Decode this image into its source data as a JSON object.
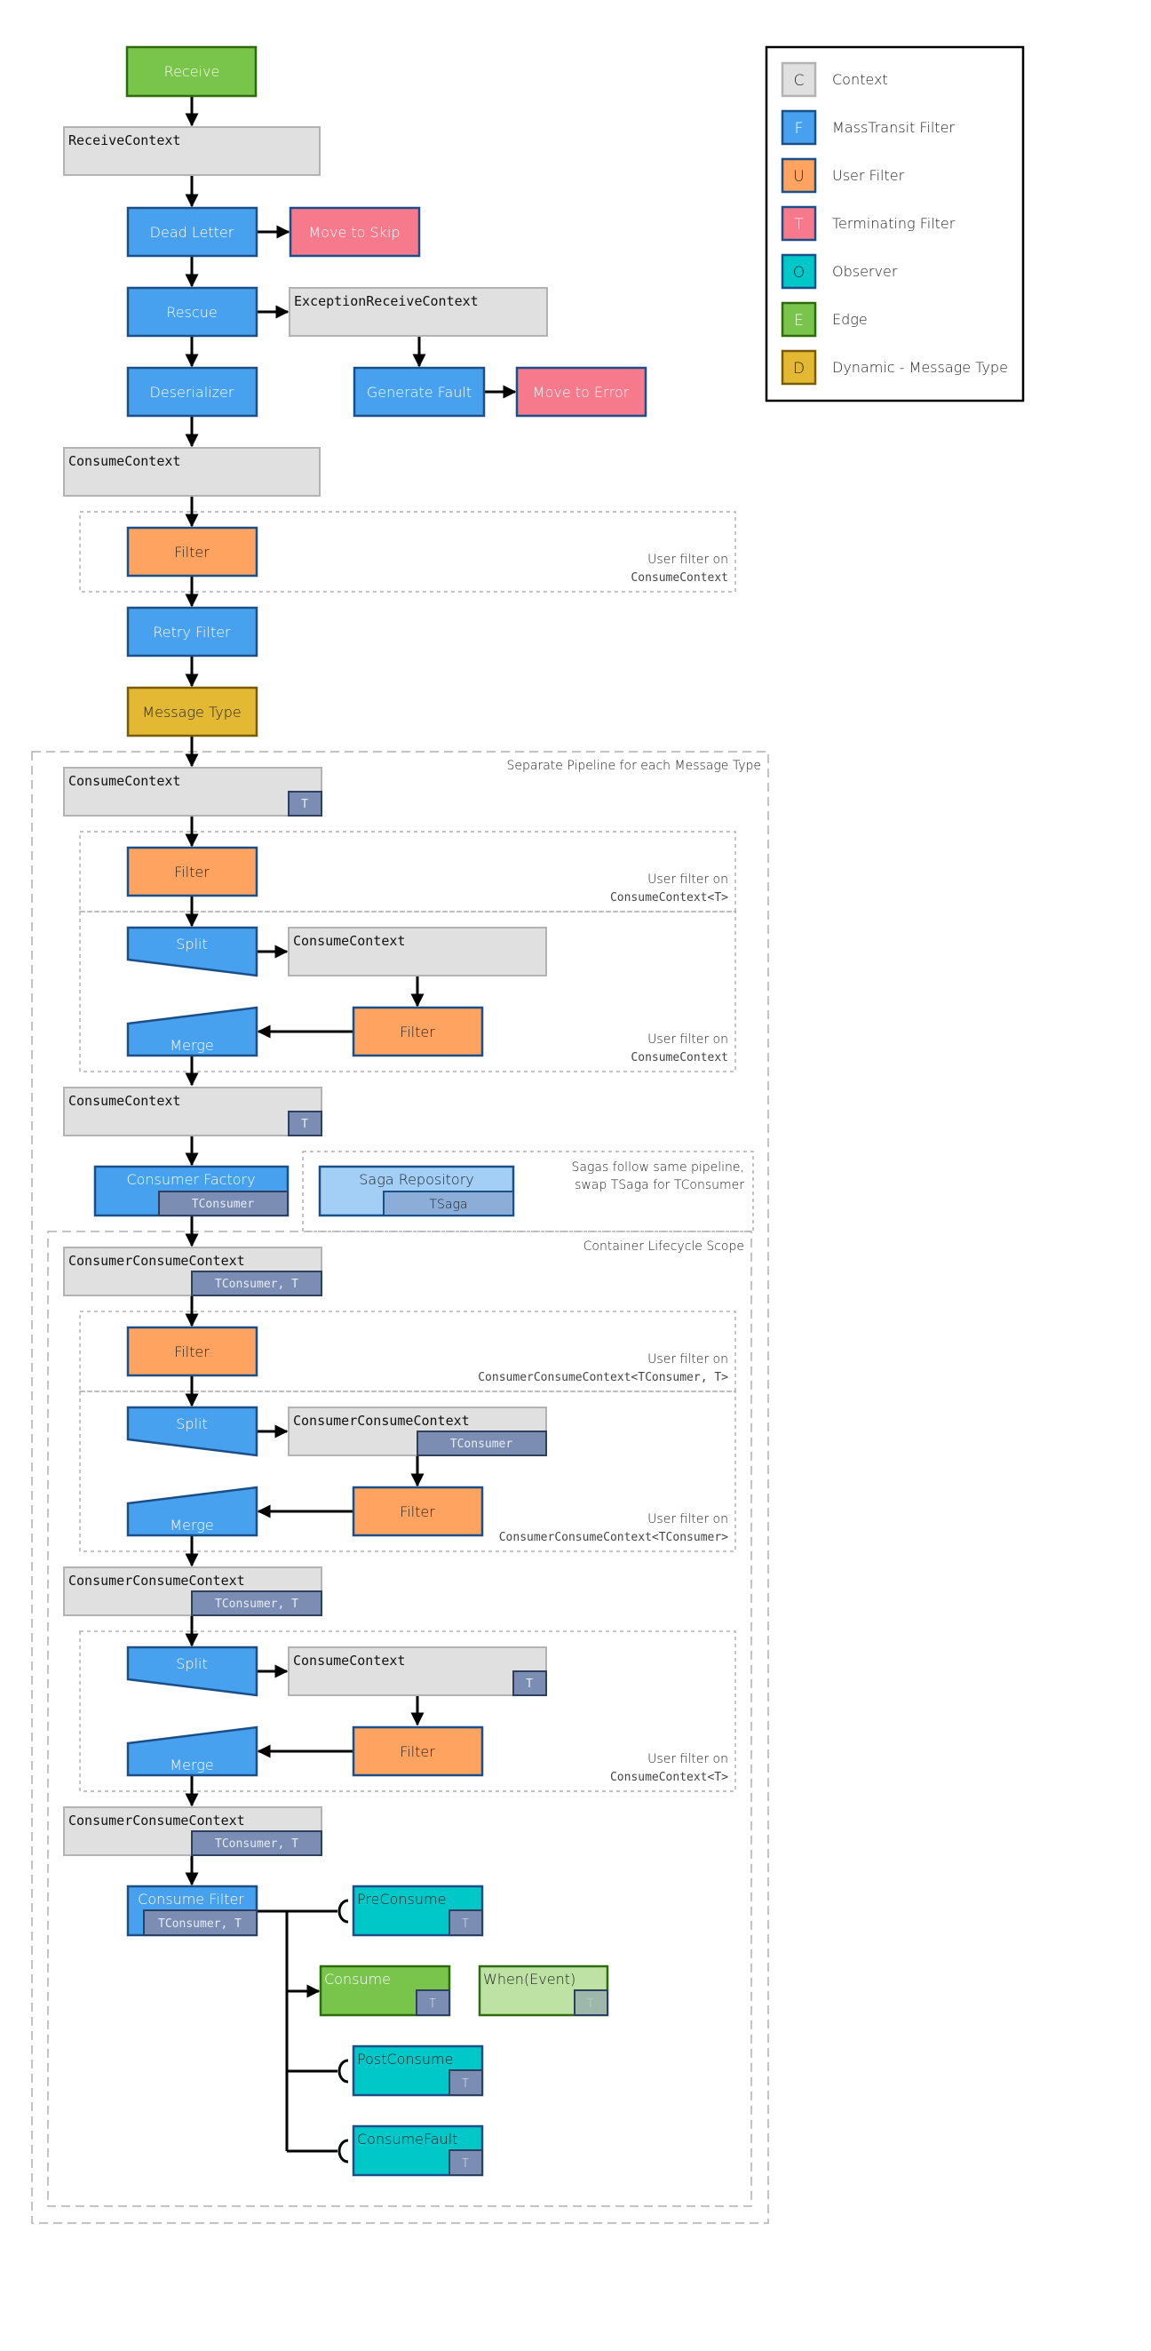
{
  "colors": {
    "context_fill": "#e0e0e0",
    "context_stroke": "#b3b3b3",
    "mt_filter_fill": "#47a1ef",
    "mt_filter_stroke": "#1a4f88",
    "user_filter_fill": "#fea460",
    "user_filter_stroke": "#1a4f88",
    "terminating_fill": "#f67a8c",
    "terminating_stroke": "#1a4f88",
    "observer_fill": "#00c8c8",
    "observer_stroke": "#1a4f88",
    "edge_fill": "#79c44a",
    "edge_stroke": "#2f6a0e",
    "dynamic_fill": "#e3b934",
    "dynamic_stroke": "#7a5a05",
    "badge_fill": "#7b8db3",
    "badge_stroke": "#2e3f5f",
    "saga_fill": "#a3cff6",
    "saga_badge_fill": "#8badd8",
    "when_fill": "#bde2a3",
    "when_badge_fill": "#9db8aa"
  },
  "legend": [
    {
      "glyph": "C",
      "label": "Context",
      "kind": "context"
    },
    {
      "glyph": "F",
      "label": "MassTransit Filter",
      "kind": "mt_filter"
    },
    {
      "glyph": "U",
      "label": "User Filter",
      "kind": "user_filter"
    },
    {
      "glyph": "T",
      "label": "Terminating Filter",
      "kind": "terminating"
    },
    {
      "glyph": "O",
      "label": "Observer",
      "kind": "observer"
    },
    {
      "glyph": "E",
      "label": "Edge",
      "kind": "edge"
    },
    {
      "glyph": "D",
      "label": "Dynamic - Message Type",
      "kind": "dynamic"
    }
  ],
  "nodes": {
    "receive": "Receive",
    "receive_context": "ReceiveContext",
    "dead_letter": "Dead Letter",
    "move_to_skip": "Move to Skip",
    "rescue": "Rescue",
    "exception_receive_context": "ExceptionReceiveContext",
    "deserializer": "Deserializer",
    "generate_fault": "Generate Fault",
    "move_to_error": "Move to Error",
    "consume_context_1": "ConsumeContext",
    "filter_1": "Filter",
    "retry_filter": "Retry Filter",
    "message_type": "Message Type",
    "consume_context_t_1": "ConsumeContext",
    "consume_context_t_1_badge": "T",
    "filter_2": "Filter",
    "split_1": "Split",
    "consume_context_inner_1": "ConsumeContext",
    "filter_3": "Filter",
    "merge_1": "Merge",
    "consume_context_t_2": "ConsumeContext",
    "consume_context_t_2_badge": "T",
    "consumer_factory": "Consumer Factory",
    "consumer_factory_badge": "TConsumer",
    "saga_repository": "Saga Repository",
    "saga_repository_badge": "TSaga",
    "ccc_1": "ConsumerConsumeContext",
    "ccc_1_badge": "TConsumer, T",
    "filter_4": "Filter",
    "split_2": "Split",
    "ccc_inner": "ConsumerConsumeContext",
    "ccc_inner_badge": "TConsumer",
    "filter_5": "Filter",
    "merge_2": "Merge",
    "ccc_2": "ConsumerConsumeContext",
    "ccc_2_badge": "TConsumer, T",
    "split_3": "Split",
    "consume_context_inner_2": "ConsumeContext",
    "consume_context_inner_2_badge": "T",
    "filter_6": "Filter",
    "merge_3": "Merge",
    "ccc_3": "ConsumerConsumeContext",
    "ccc_3_badge": "TConsumer, T",
    "consume_filter": "Consume Filter",
    "consume_filter_badge": "TConsumer, T",
    "pre_consume": "PreConsume",
    "pre_consume_badge": "T",
    "consume": "Consume",
    "consume_badge": "T",
    "when_event": "When(Event)",
    "when_event_badge": "T",
    "post_consume": "PostConsume",
    "post_consume_badge": "T",
    "consume_fault": "ConsumeFault",
    "consume_fault_badge": "T"
  },
  "groups": {
    "user_filter_on": "User filter on",
    "g1_type": "ConsumeContext",
    "separate_pipeline": "Separate Pipeline for each Message Type",
    "g2_type": "ConsumeContext<T>",
    "g3_type": "ConsumeContext",
    "sagas_line1": "Sagas follow same pipeline,",
    "sagas_line2": "swap TSaga for TConsumer",
    "container_scope": "Container Lifecycle Scope",
    "g4_type": "ConsumerConsumeContext<TConsumer, T>",
    "g5_type": "ConsumerConsumeContext<TConsumer>",
    "g6_type": "ConsumeContext<T>"
  }
}
